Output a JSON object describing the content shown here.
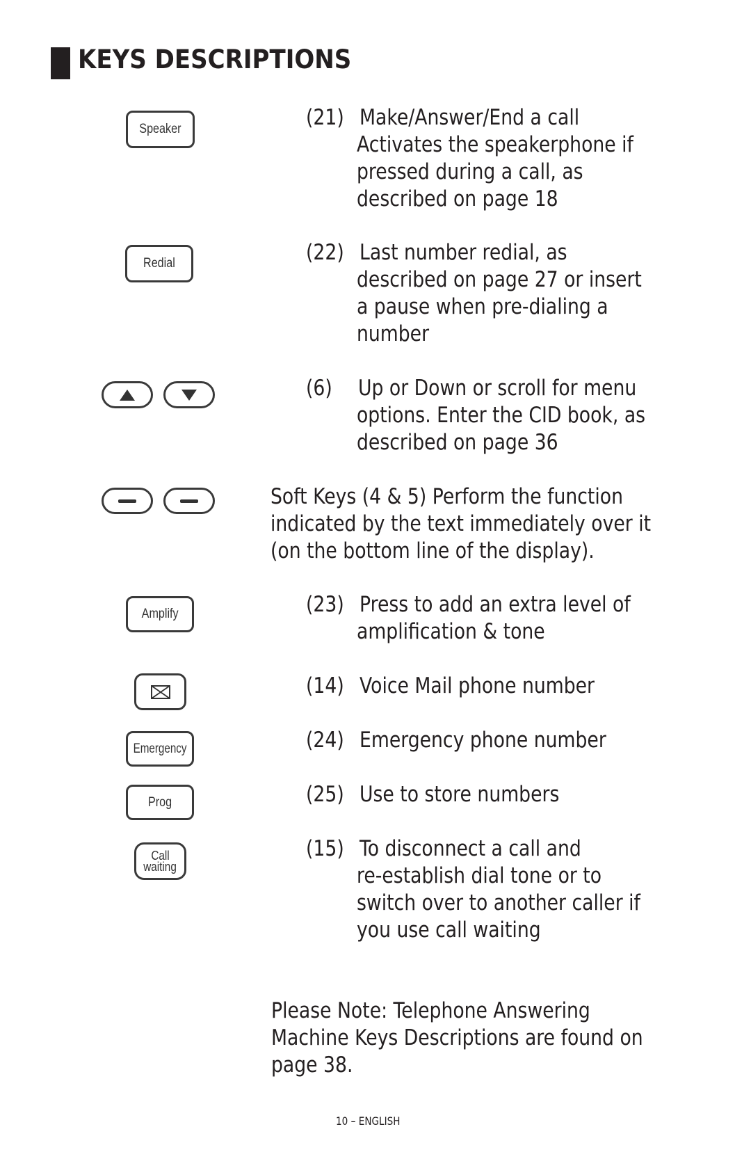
{
  "page": {
    "title": "KEYS DESCRIPTIONS",
    "footer": "10 – ENGLISH"
  },
  "keys": {
    "speaker": "Speaker",
    "redial": "Redial",
    "amplify": "Amplify",
    "emergency": "Emergency",
    "prog": "Prog",
    "call_waiting_line1": "Call",
    "call_waiting_line2": "waiting"
  },
  "items": [
    {
      "num": "(21)",
      "lines": [
        "Make/Answer/End a call",
        "Activates the speakerphone if",
        "pressed during a call, as",
        "described on page 18"
      ]
    },
    {
      "num": "(22)",
      "lines": [
        "Last number redial, as",
        "described on page 27 or insert",
        "a pause when pre-dialing a",
        "number"
      ]
    },
    {
      "num": "(6)",
      "lines": [
        "Up or Down or scroll for menu",
        "options. Enter the CID book, as",
        "described on page 36"
      ]
    },
    {
      "num": "(23)",
      "lines": [
        "Press to add an extra level of",
        "amplification & tone"
      ]
    },
    {
      "num": "(14)",
      "lines": [
        "Voice Mail phone number"
      ]
    },
    {
      "num": "(24)",
      "lines": [
        "Emergency phone number"
      ]
    },
    {
      "num": "(25)",
      "lines": [
        "Use to store numbers"
      ]
    },
    {
      "num": "(15)",
      "lines": [
        "To disconnect a call and",
        "re-establish dial tone or to",
        "switch over to another caller if",
        "you use call waiting"
      ]
    }
  ],
  "soft_keys": {
    "lines": [
      "Soft Keys (4 & 5) Perform the function",
      "indicated by the text immediately over it",
      "(on the bottom line of the display)."
    ]
  },
  "note": {
    "lines": [
      "Please Note: Telephone Answering",
      "Machine Keys Descriptions are found on",
      "page 38."
    ]
  }
}
